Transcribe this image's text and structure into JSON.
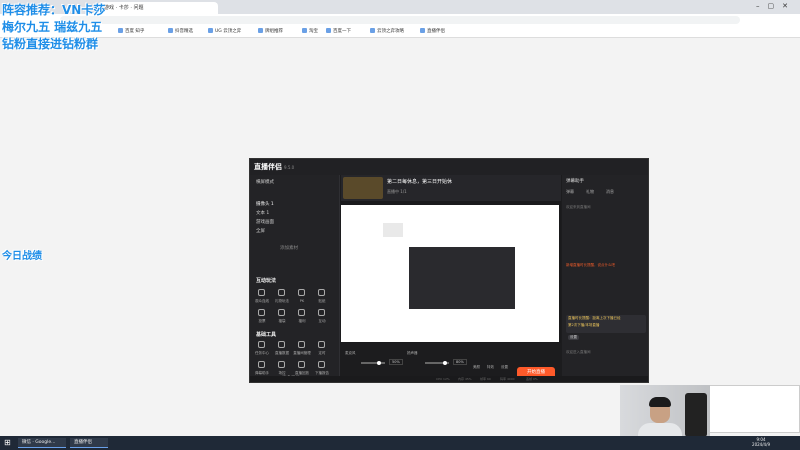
{
  "overlay": {
    "line1": "阵容推荐：VN卡莎",
    "line2": "梅尔九五 瑞兹九五",
    "line3": "钻粉直接进钻粉群",
    "stats": "今日战绩"
  },
  "browser": {
    "tab_title": "游戏 · 卡莎 · 问题",
    "url": "",
    "bookmarks": [
      "百度 知乎",
      "抖音精选",
      "UG 云顶之弈",
      "牌组推荐",
      "淘宝",
      "百度一下",
      "云顶之弈攻略",
      "直播伴侣"
    ]
  },
  "app": {
    "name": "直播伴侣",
    "version": "9.5.0",
    "sidebar": {
      "mode": "横屏模式",
      "add_scene": "添加素材",
      "scenes": [
        "摄像头 1",
        "文本 1",
        "游戏画面",
        "全屏"
      ],
      "section_interact": "互动玩法",
      "interact_items": [
        "观众连线",
        "礼物玩法",
        "PK",
        "贴纸",
        "投票",
        "福袋",
        "福利",
        "互动"
      ],
      "section_tools": "基础工具",
      "tool_items": [
        "任务中心",
        "直播数据",
        "直播间管理",
        "定时",
        "弹幕助手",
        "场控",
        "直播回放",
        "下播报告"
      ],
      "more_tools": "更多工具"
    },
    "stream": {
      "title": "第二日每休息，第三日开始休",
      "sub": "直播中 1/1"
    },
    "controls": {
      "mic_label": "麦克风",
      "mic_pct": "50%",
      "speaker_label": "扬声器",
      "speaker_pct": "80%",
      "start": "开始直播",
      "icons": [
        "美颜",
        "特效",
        "设置"
      ]
    },
    "right": {
      "header": "弹幕助手",
      "tabs": [
        "弹幕",
        "礼物",
        "消息"
      ],
      "msg1": "新增直播时长提醒，说点什么吧",
      "msg2": "欢迎来到直播间",
      "bubble1": "直播时长提醒：距离上次下播已经",
      "bubble2": "第2次下播/本场直播",
      "badge": "设置",
      "foot": "欢迎进入直播间"
    },
    "status": [
      "CPU 12%",
      "内存 45%",
      "帧率 60",
      "码率 4000",
      "丢帧 0%"
    ]
  },
  "taskbar": {
    "items": [
      "微信 · Google...",
      "直播伴侣"
    ],
    "time": "9:04",
    "date": "2024/4/9"
  }
}
